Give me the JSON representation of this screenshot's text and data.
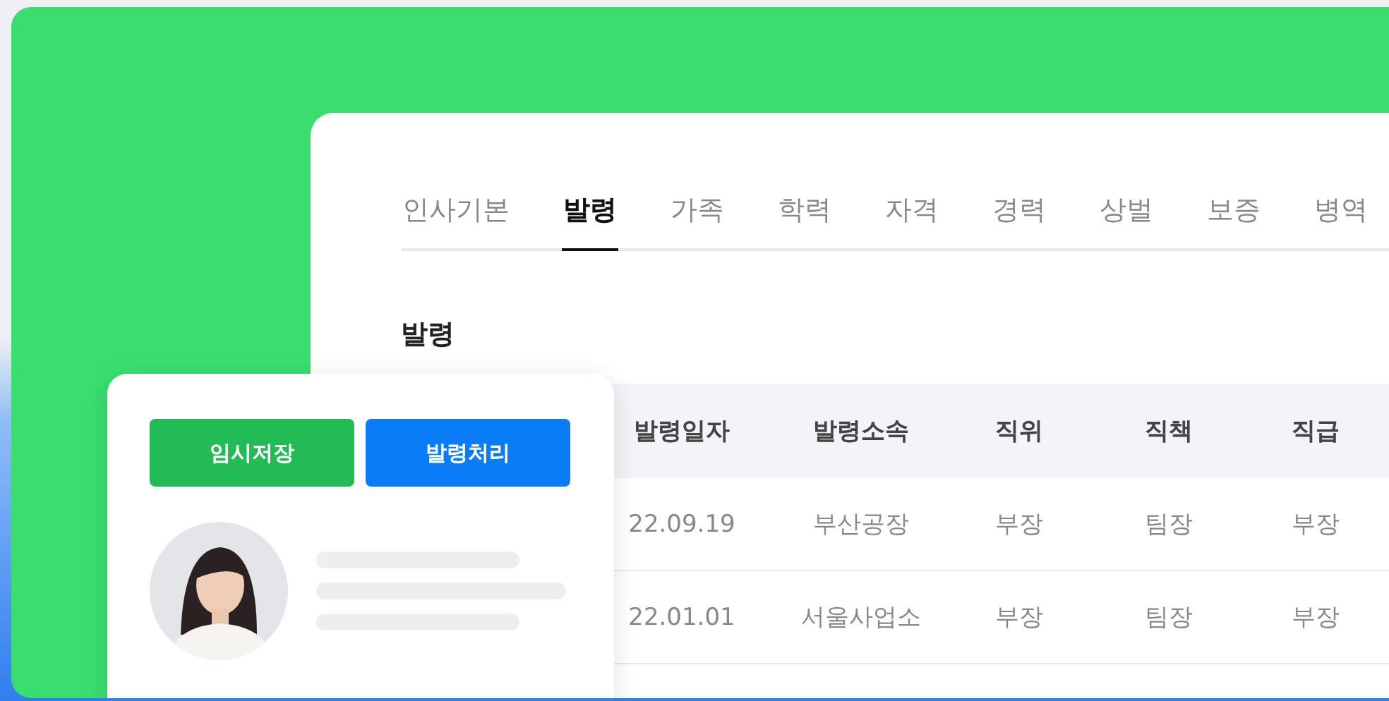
{
  "tabs": [
    {
      "label": "인사기본",
      "selected": false
    },
    {
      "label": "발령",
      "selected": true
    },
    {
      "label": "가족",
      "selected": false
    },
    {
      "label": "학력",
      "selected": false
    },
    {
      "label": "자격",
      "selected": false
    },
    {
      "label": "경력",
      "selected": false
    },
    {
      "label": "상벌",
      "selected": false
    },
    {
      "label": "보증",
      "selected": false
    },
    {
      "label": "병역",
      "selected": false
    }
  ],
  "section_title": "발령",
  "table": {
    "columns": [
      "발령일자",
      "발령소속",
      "직위",
      "직책",
      "직급"
    ],
    "rows": [
      [
        "22.09.19",
        "부산공장",
        "부장",
        "팀장",
        "부장"
      ],
      [
        "22.01.01",
        "서울사업소",
        "부장",
        "팀장",
        "부장"
      ]
    ]
  },
  "actions": [
    {
      "label": "임시저장",
      "kind": "save"
    },
    {
      "label": "발령처리",
      "kind": "issue"
    }
  ]
}
